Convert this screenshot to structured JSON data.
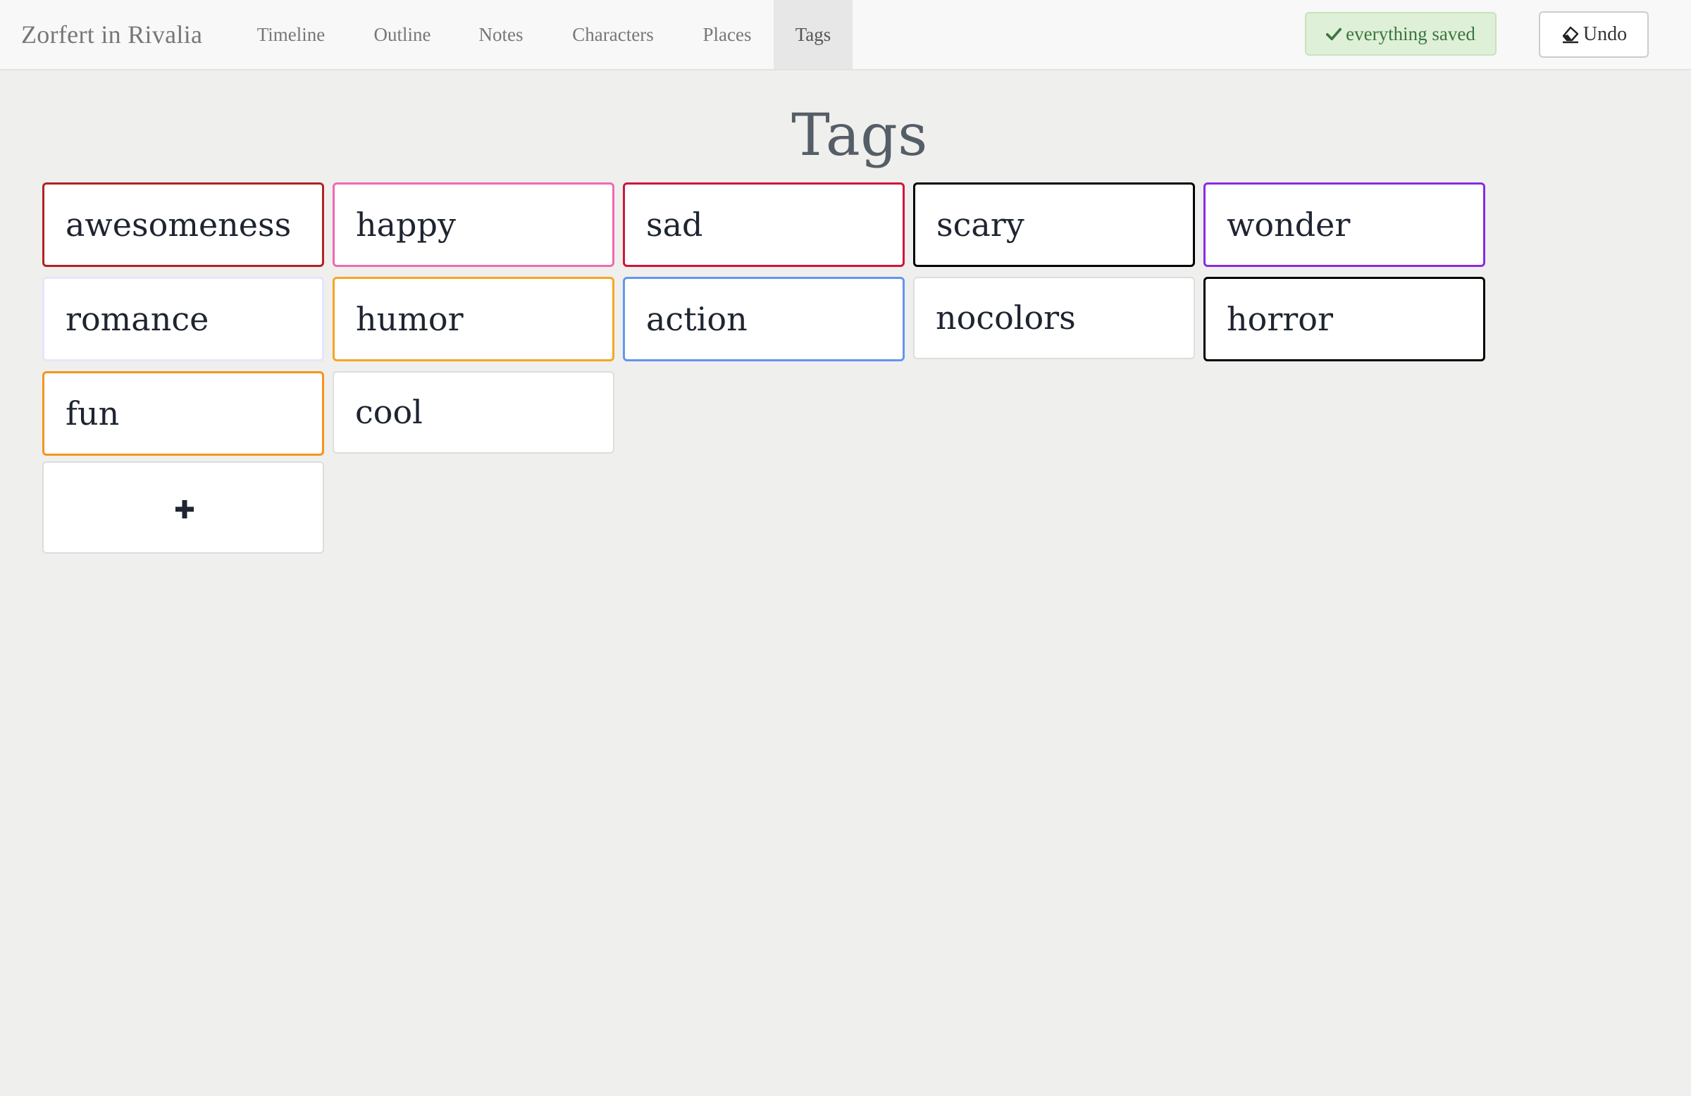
{
  "app": {
    "title": "Zorfert in Rivalia"
  },
  "nav": {
    "items": [
      {
        "label": "Timeline",
        "active": false
      },
      {
        "label": "Outline",
        "active": false
      },
      {
        "label": "Notes",
        "active": false
      },
      {
        "label": "Characters",
        "active": false
      },
      {
        "label": "Places",
        "active": false
      },
      {
        "label": "Tags",
        "active": true
      }
    ]
  },
  "status": {
    "saved_label": "everything saved",
    "saved_icon": "check-icon",
    "color": "#3c763d"
  },
  "toolbar": {
    "undo_label": "Undo",
    "undo_icon": "eraser-icon"
  },
  "page": {
    "title": "Tags"
  },
  "tags": [
    {
      "name": "awesomeness",
      "color": "#b22222"
    },
    {
      "name": "happy",
      "color": "#f06ab0"
    },
    {
      "name": "sad",
      "color": "#d0143c"
    },
    {
      "name": "scary",
      "color": "#000000"
    },
    {
      "name": "wonder",
      "color": "#8a2be2"
    },
    {
      "name": "romance",
      "color": "#e6e6fa"
    },
    {
      "name": "humor",
      "color": "#f5a623"
    },
    {
      "name": "action",
      "color": "#6495ed"
    },
    {
      "name": "nocolors",
      "color": ""
    },
    {
      "name": "horror",
      "color": "#000000"
    },
    {
      "name": "fun",
      "color": "#f5941e"
    },
    {
      "name": "cool",
      "color": ""
    }
  ],
  "add_tag": {
    "icon": "plus-icon"
  }
}
